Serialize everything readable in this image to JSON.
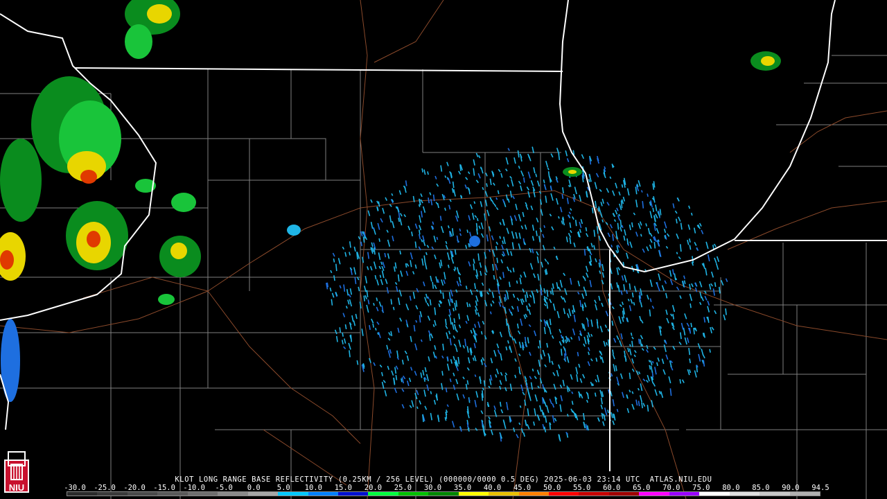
{
  "product": {
    "caption": "KLOT LONG RANGE BASE REFLECTIVITY (0.25KM / 256 LEVEL) (000000/0000 0.5 DEG) 2025-06-03 23:14 UTC  ATLAS.NIU.EDU"
  },
  "logo": {
    "text": "NIU",
    "icon": "niu-tower-icon"
  },
  "legend": {
    "labels": [
      "-30.0",
      "-25.0",
      "-20.0",
      "-15.0",
      "-10.0",
      "-5.0",
      "0.0",
      "5.0",
      "10.0",
      "15.0",
      "20.0",
      "25.0",
      "30.0",
      "35.0",
      "40.0",
      "45.0",
      "50.0",
      "55.0",
      "60.0",
      "65.0",
      "70.0",
      "75.0",
      "80.0",
      "85.0",
      "90.0",
      "94.5"
    ],
    "colors": [
      "#2b2b2b",
      "#3a3a3a",
      "#4a4a4a",
      "#5a5a5a",
      "#6e6e6e",
      "#8a8a8a",
      "#a6a6a6",
      "#00c8ff",
      "#0080ff",
      "#0010d0",
      "#00ff40",
      "#00c000",
      "#008800",
      "#ffff00",
      "#e8c000",
      "#ff8000",
      "#ff0000",
      "#c80000",
      "#a00000",
      "#ff00ff",
      "#9a00ff",
      "#ffffff",
      "#e0e0e0",
      "#c8c8c8",
      "#b0b0b0"
    ]
  },
  "colors": {
    "background": "#000000",
    "state_border": "#ffffff",
    "county_border": "#808080",
    "roads": "#8b4a2b",
    "clutter": "#1fb5e6"
  }
}
